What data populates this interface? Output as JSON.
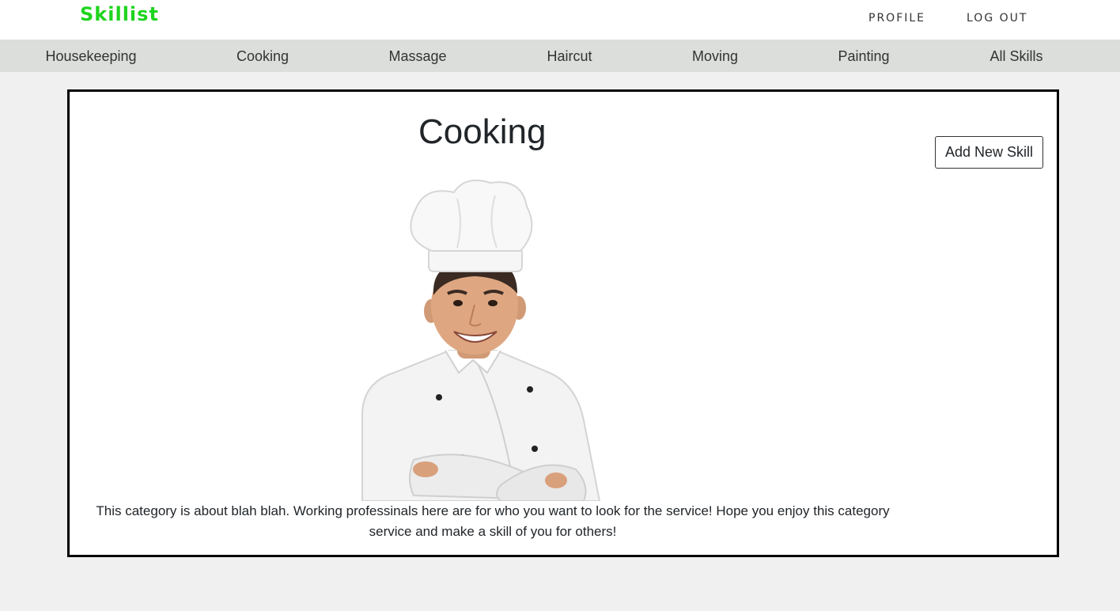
{
  "header": {
    "logo": "Skillist",
    "links": {
      "profile": "PROFILE",
      "logout": "LOG OUT"
    }
  },
  "categories": [
    "Housekeeping",
    "Cooking",
    "Massage",
    "Haircut",
    "Moving",
    "Painting",
    "All Skills"
  ],
  "category_page": {
    "title": "Cooking",
    "add_button": "Add New Skill",
    "image": "chef-photo",
    "description": "This category is about blah blah. Working professinals here are for who you want to look for the service! Hope you enjoy this category service and make a skill of you for others!"
  },
  "colors": {
    "logo": "#1ed41e",
    "category_bar": "#dcdedb",
    "page_background": "#f0f0f0",
    "card_border": "#000000"
  }
}
